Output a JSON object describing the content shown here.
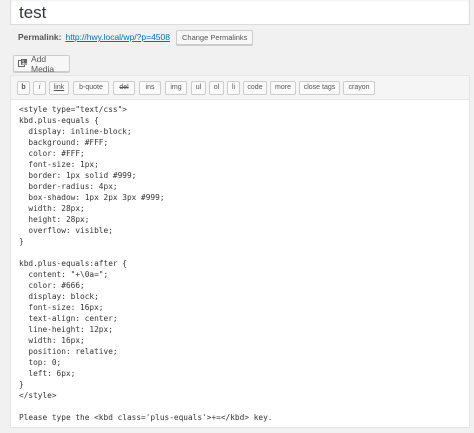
{
  "post": {
    "title": "test"
  },
  "permalink": {
    "label": "Permalink:",
    "url": "http://hwy.local/wp/?p=4508",
    "change_button": "Change Permalinks"
  },
  "media": {
    "add_media_label": "Add Media"
  },
  "quicktags": [
    {
      "id": "b",
      "label": "b"
    },
    {
      "id": "i",
      "label": "i"
    },
    {
      "id": "link",
      "label": "link"
    },
    {
      "id": "b-quote",
      "label": "b-quote"
    },
    {
      "id": "del",
      "label": "del"
    },
    {
      "id": "ins",
      "label": "ins"
    },
    {
      "id": "img",
      "label": "img"
    },
    {
      "id": "ul",
      "label": "ul"
    },
    {
      "id": "ol",
      "label": "ol"
    },
    {
      "id": "li",
      "label": "li"
    },
    {
      "id": "code",
      "label": "code"
    },
    {
      "id": "more",
      "label": "more"
    },
    {
      "id": "close-tags",
      "label": "close tags"
    },
    {
      "id": "crayon",
      "label": "crayon"
    }
  ],
  "content_lines": [
    "<style type=\"text/css\">",
    "kbd.plus-equals {",
    "  display: inline-block;",
    "  background: #FFF;",
    "  color: #FFF;",
    "  font-size: 1px;",
    "  border: 1px solid #999;",
    "  border-radius: 4px;",
    "  box-shadow: 1px 2px 3px #999;",
    "  width: 28px;",
    "  height: 28px;",
    "  overflow: visible;",
    "}",
    "",
    "kbd.plus-equals:after {",
    "  content: \"+\\0a=\";",
    "  color: #666;",
    "  display: block;",
    "  font-size: 16px;",
    "  text-align: center;",
    "  line-height: 12px;",
    "  width: 16px;",
    "  position: relative;",
    "  top: 0;",
    "  left: 6px;",
    "}",
    "</style>",
    "",
    "Please type the <kbd class='plus-equals'>+=</kbd> key."
  ],
  "colors": {
    "link": "#0073aa",
    "toolbar_bg": "#f5f5f5",
    "editor_bg": "#ffffff",
    "page_bg": "#f1f1f1"
  }
}
